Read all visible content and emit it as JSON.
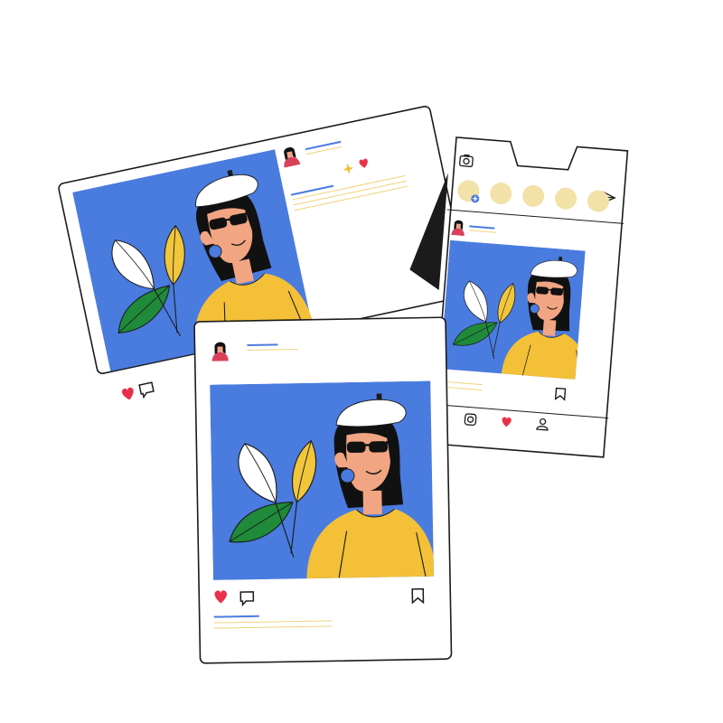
{
  "scene": {
    "description_label": "",
    "icons": {
      "like": "heart-icon",
      "comment": "comment-icon",
      "save": "bookmark-icon",
      "camera": "camera-icon",
      "send": "send-icon",
      "home": "instagram-icon",
      "profile": "profile-icon",
      "add_story": "plus-icon",
      "sparkle": "sparkle-icon"
    }
  },
  "palette": {
    "photo_bg": "#4a7bdf",
    "sweater": "#f3c038",
    "hair": "#111111",
    "skin": "#f1a582",
    "beret": "#ffffff",
    "leaf_green": "#1f8a3a",
    "leaf_yellow": "#f1c63c",
    "heart_red": "#e8304a",
    "line_blue": "#4a7bdf",
    "line_yellow": "#f0d27a",
    "story_circle": "#f2e2a8",
    "outline": "#1b1b1b",
    "avatar_top": "#d9405a"
  },
  "stories": {
    "count": 5
  }
}
